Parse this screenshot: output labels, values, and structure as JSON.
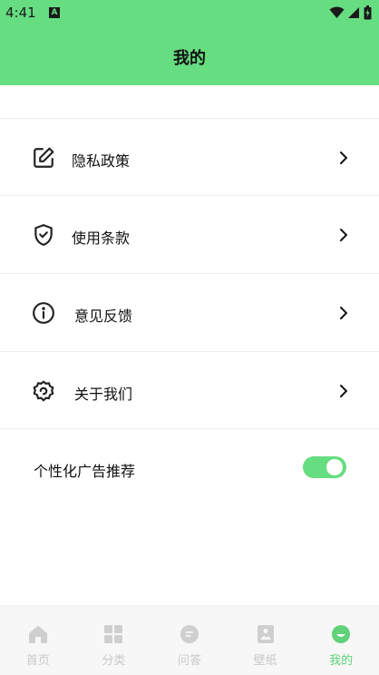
{
  "status": {
    "time": "4:41",
    "a_badge": "A"
  },
  "header": {
    "title": "我的"
  },
  "menu": [
    {
      "label": "隐私政策",
      "icon": "edit-icon"
    },
    {
      "label": "使用条款",
      "icon": "shield-check-icon"
    },
    {
      "label": "意见反馈",
      "icon": "info-icon"
    },
    {
      "label": "关于我们",
      "icon": "gear-icon"
    }
  ],
  "ad": {
    "label": "个性化广告推荐",
    "enabled": true
  },
  "nav": [
    {
      "label": "首页",
      "icon": "home-icon",
      "active": false
    },
    {
      "label": "分类",
      "icon": "grid-icon",
      "active": false
    },
    {
      "label": "问答",
      "icon": "chat-icon",
      "active": false
    },
    {
      "label": "壁纸",
      "icon": "image-icon",
      "active": false
    },
    {
      "label": "我的",
      "icon": "profile-icon",
      "active": true
    }
  ],
  "colors": {
    "brand": "#66dd80",
    "nav_inactive": "#c8c8c8",
    "nav_active": "#5fd27a"
  }
}
